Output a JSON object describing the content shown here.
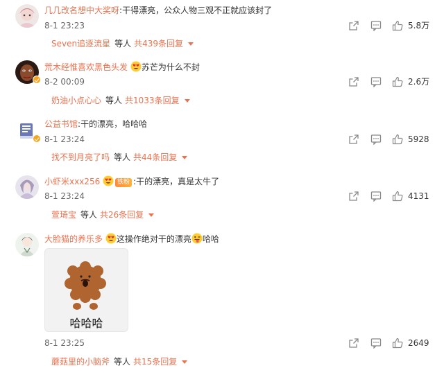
{
  "comments": [
    {
      "username": "几几改名想中大奖呀",
      "text": "干得漂亮，公众人物三观不正就应该封了",
      "time": "8-1 23:23",
      "likes": "5.8万",
      "replies": {
        "first_user": "Seven追逐流星",
        "middle": "等人",
        "total": "共439条回复"
      }
    },
    {
      "username": "荒木经惟喜欢黑色头发",
      "text": "苏芒为什么不封",
      "time": "8-2 00:09",
      "likes": "2.6万",
      "replies": {
        "first_user": "奶油小点心心",
        "middle": "等人",
        "total": "共1033条回复"
      }
    },
    {
      "username": "公益书馆",
      "text": "干的漂亮，哈哈哈",
      "time": "8-1 23:24",
      "likes": "5928",
      "replies": {
        "first_user": "找不到月亮了吗",
        "middle": "等人",
        "total": "共44条回复"
      }
    },
    {
      "username": "小虾米xxx256",
      "badge": "铁粉",
      "text": "干的漂亮，真是太牛了",
      "time": "8-1 23:24",
      "likes": "4131",
      "replies": {
        "first_user": "萱琦宝",
        "middle": "等人",
        "total": "共26条回复"
      }
    },
    {
      "username": "大脸猫的养乐多",
      "text_a": "这操作绝对干的漂亮",
      "text_b": "哈哈",
      "sticker_caption": "哈哈哈",
      "time": "8-1 23:25",
      "likes": "2649",
      "replies": {
        "first_user": "蘑菇里的小脑斧",
        "middle": "等人",
        "total": "共15条回复"
      }
    }
  ],
  "colors": {
    "username": "#eb7350",
    "text": "#333333",
    "meta": "#666666",
    "icon": "#888888",
    "verified": "#f5a623"
  },
  "icons": [
    "share-icon",
    "comment-icon",
    "like-icon",
    "verified-icon",
    "heart-eyes-emoji",
    "tongue-out-emoji",
    "caret-down-icon"
  ]
}
